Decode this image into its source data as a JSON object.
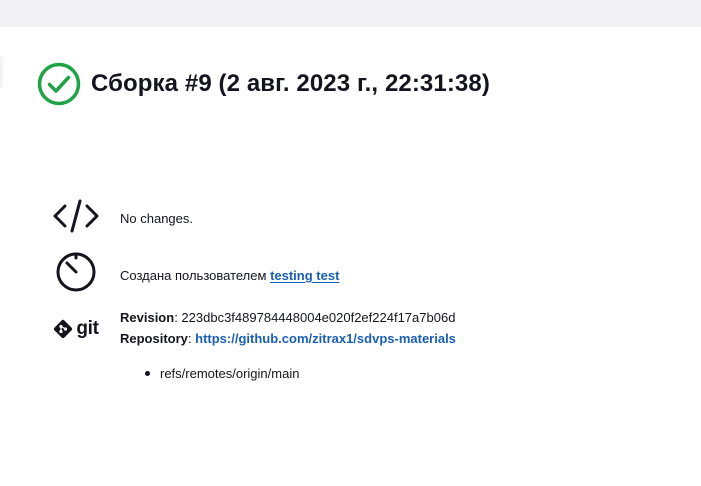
{
  "build": {
    "title": "Сборка #9 (2 авг. 2023 г., 22:31:38)",
    "status_icon": "check-circle-icon",
    "status_color": "#1ea446"
  },
  "changes": {
    "icon": "code-icon",
    "text": "No changes."
  },
  "cause": {
    "icon": "timer-icon",
    "prefix": "Создана пользователем",
    "user_link": "testing test"
  },
  "git": {
    "icon": "git-logo-icon",
    "logo_text": "git",
    "revision_label": "Revision",
    "revision_value": "223dbc3f489784448004e020f2ef224f17a7b06d",
    "repository_label": "Repository",
    "repository_link": "https://github.com/zitrax1/sdvps-materials",
    "branches": [
      "refs/remotes/origin/main"
    ]
  },
  "colors": {
    "link": "#1a5fb4",
    "text": "#14141f",
    "topbar": "#f3f3f6"
  }
}
